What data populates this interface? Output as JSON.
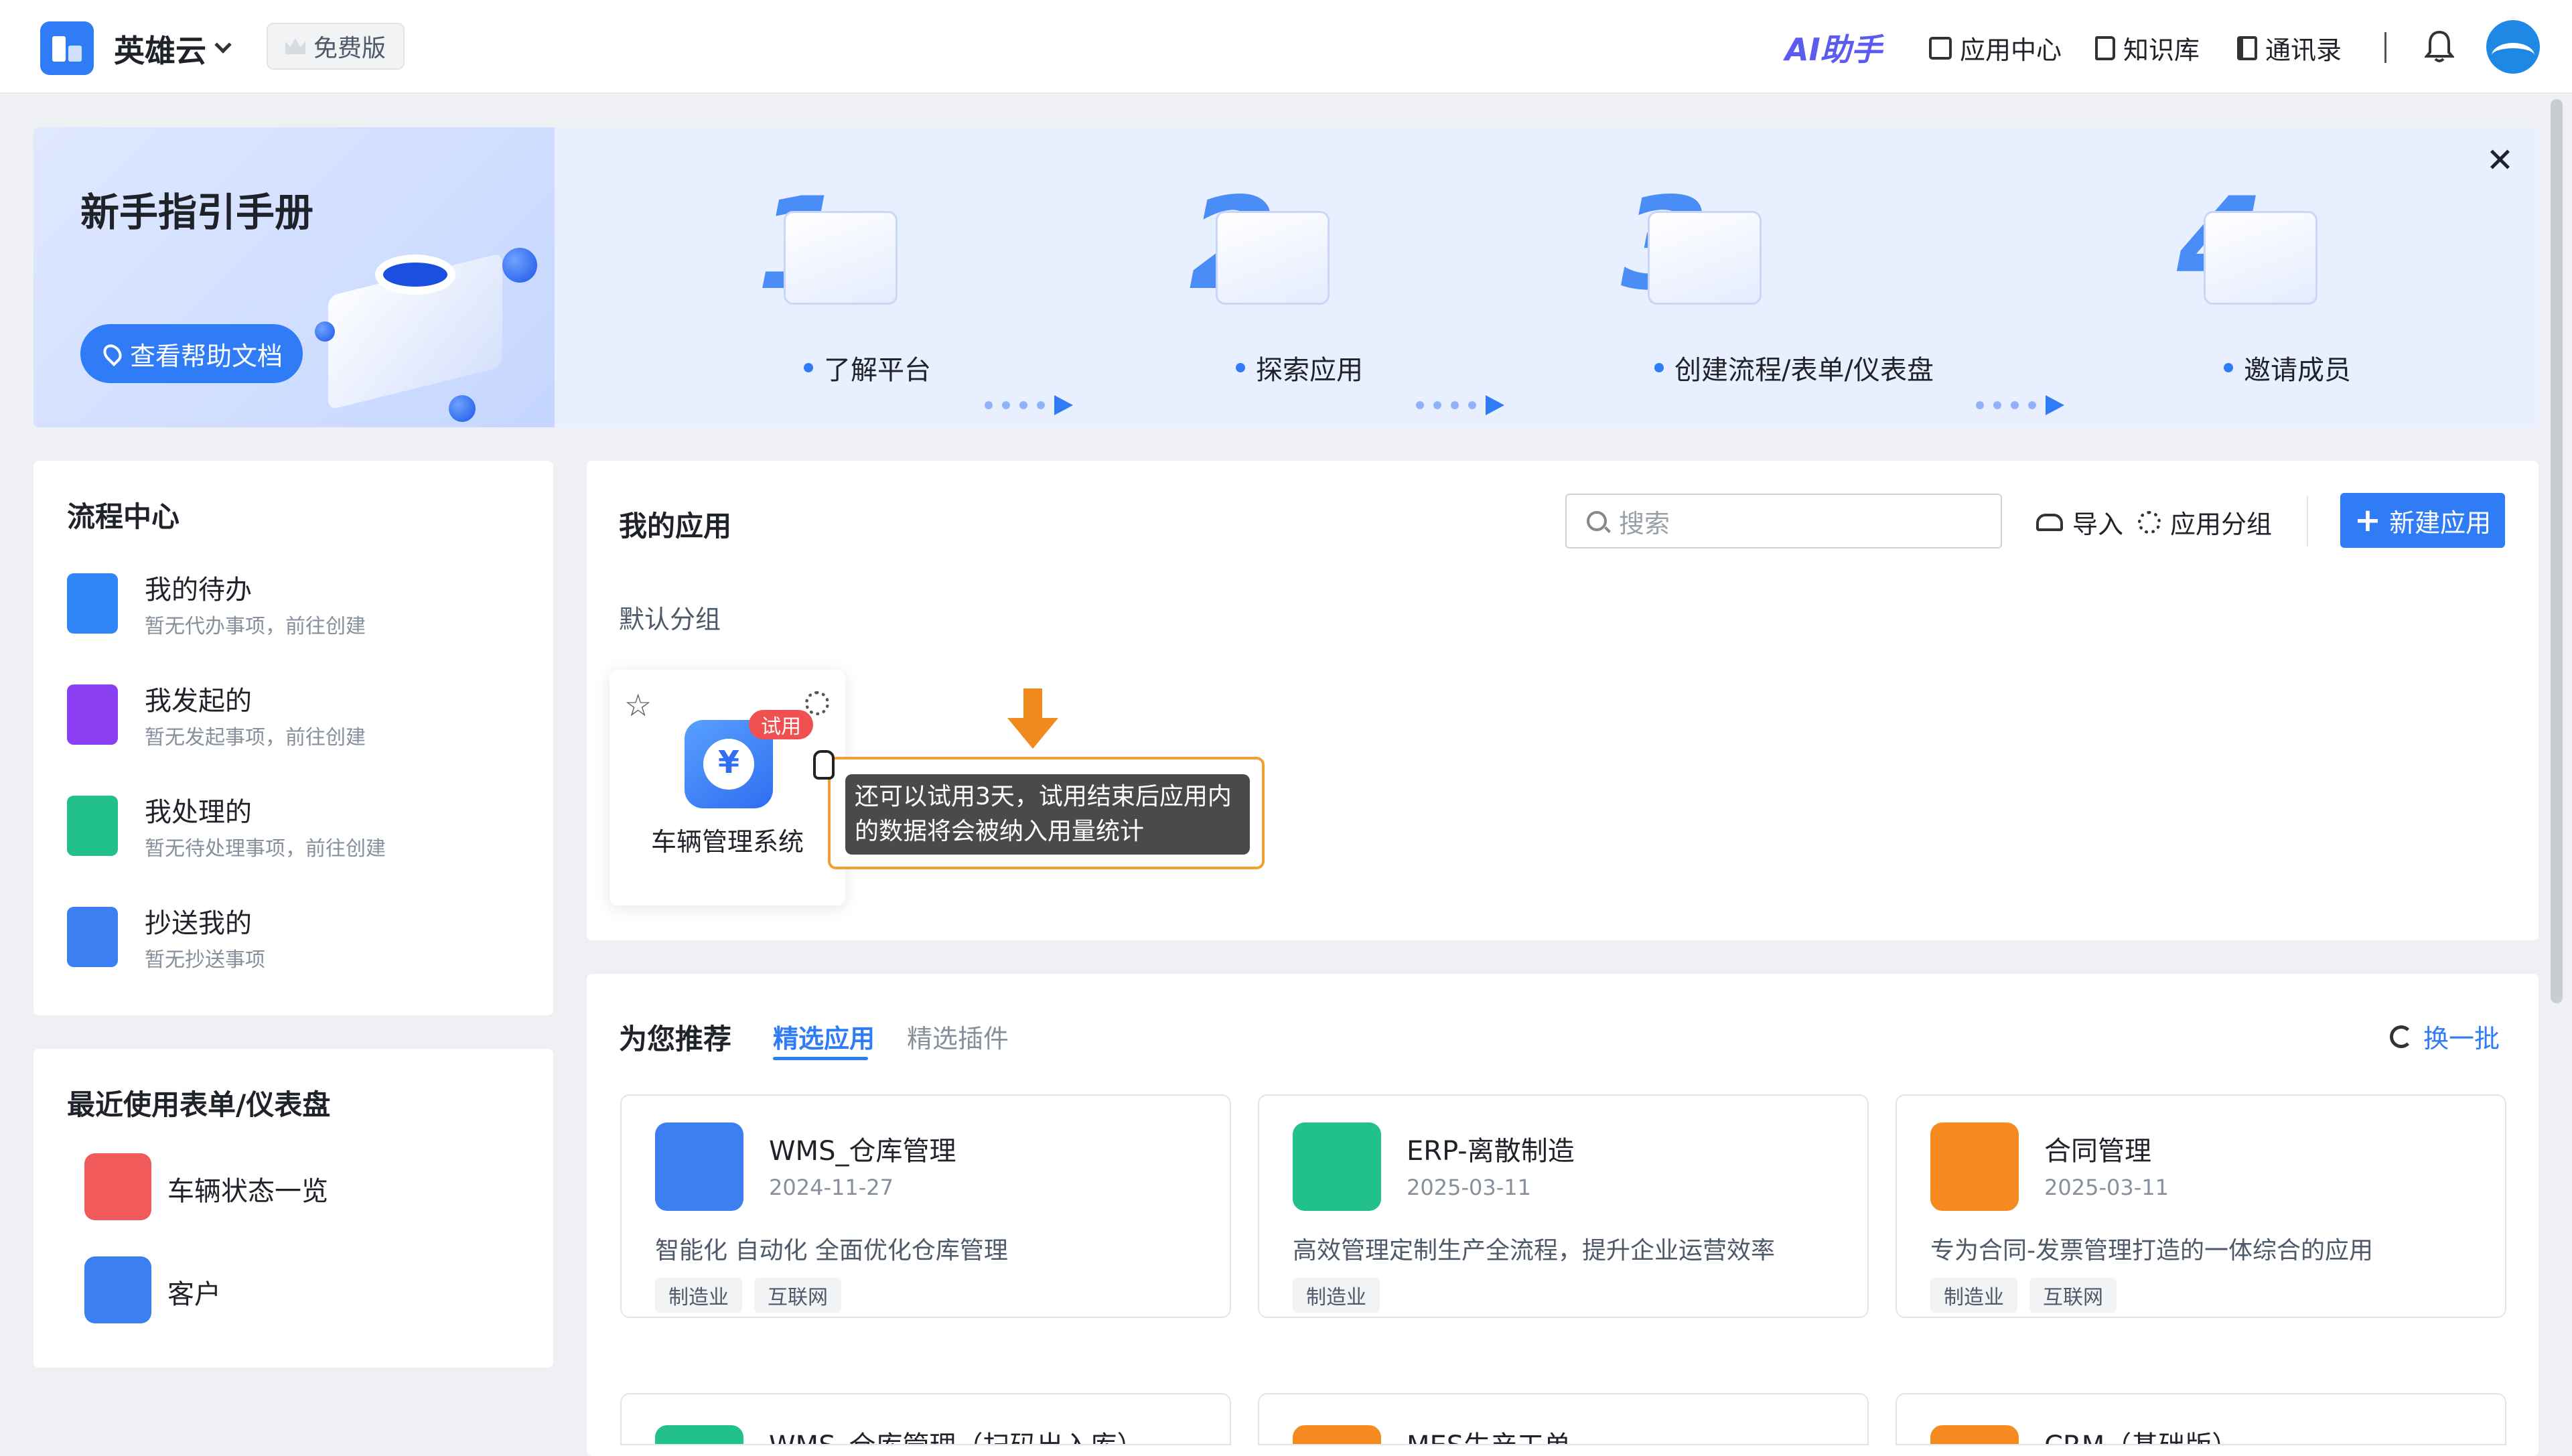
{
  "header": {
    "brand": "英雄云",
    "plan_badge": "免费版",
    "ai_label": "AI助手",
    "nav": [
      "应用中心",
      "知识库",
      "通讯录"
    ]
  },
  "guide": {
    "title": "新手指引手册",
    "help_button": "查看帮助文档",
    "steps": [
      {
        "num": "1",
        "label": "了解平台"
      },
      {
        "num": "2",
        "label": "探索应用"
      },
      {
        "num": "3",
        "label": "创建流程/表单/仪表盘"
      },
      {
        "num": "4",
        "label": "邀请成员"
      }
    ]
  },
  "flow_center": {
    "title": "流程中心",
    "items": [
      {
        "name": "我的待办",
        "sub": "暂无代办事项，前往创建",
        "color": "#2f86f6"
      },
      {
        "name": "我发起的",
        "sub": "暂无发起事项，前往创建",
        "color": "#8a3ff2"
      },
      {
        "name": "我处理的",
        "sub": "暂无待处理事项，前往创建",
        "color": "#22c08a"
      },
      {
        "name": "抄送我的",
        "sub": "暂无抄送事项",
        "color": "#3b7ff0"
      }
    ]
  },
  "recent": {
    "title": "最近使用表单/仪表盘",
    "items": [
      {
        "name": "车辆状态一览",
        "color": "#f05a5a"
      },
      {
        "name": "客户",
        "color": "#3b7ff0"
      }
    ]
  },
  "my_apps": {
    "title": "我的应用",
    "search_placeholder": "搜索",
    "import_label": "导入",
    "group_label": "应用分组",
    "new_button": "新建应用",
    "default_group": "默认分组",
    "app": {
      "name": "车辆管理系统",
      "badge": "试用"
    },
    "tooltip_line1": "还可以试用3天，试用结束后应用内",
    "tooltip_line2": "的数据将会被纳入用量统计"
  },
  "recommend": {
    "title": "为您推荐",
    "tabs": [
      "精选应用",
      "精选插件"
    ],
    "refresh": "换一批",
    "cards": [
      {
        "name": "WMS_仓库管理",
        "date": "2024-11-27",
        "desc": "智能化 自动化 全面优化仓库管理",
        "tags": [
          "制造业",
          "互联网"
        ],
        "color": "#3b7ff0"
      },
      {
        "name": "ERP-离散制造",
        "date": "2025-03-11",
        "desc": "高效管理定制生产全流程，提升企业运营效率",
        "tags": [
          "制造业"
        ],
        "color": "#22c08a"
      },
      {
        "name": "合同管理",
        "date": "2025-03-11",
        "desc": "专为合同-发票管理打造的一体综合的应用",
        "tags": [
          "制造业",
          "互联网"
        ],
        "color": "#f58a1f"
      }
    ],
    "cards_row2": [
      {
        "name": "WMS_仓库管理（扫码出入库）",
        "color": "#22c08a"
      },
      {
        "name": "MES生产工单",
        "color": "#f58a1f"
      },
      {
        "name": "CRM（基础版）",
        "color": "#f58a1f"
      }
    ]
  }
}
